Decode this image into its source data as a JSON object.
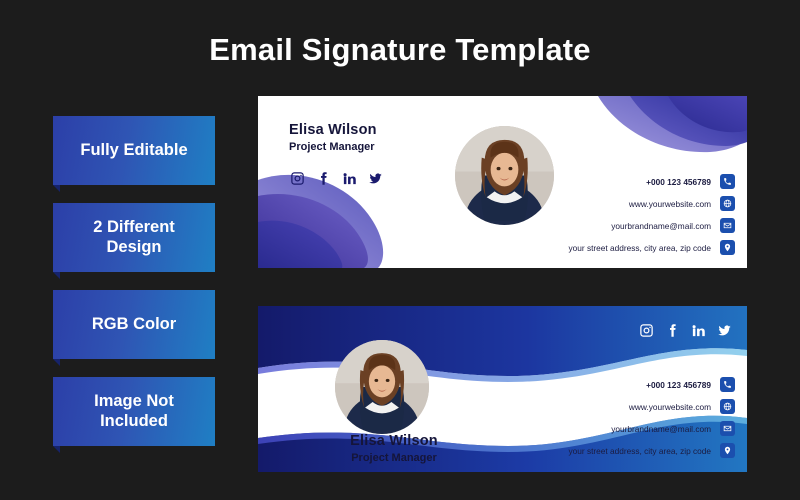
{
  "title": "Email Signature Template",
  "badges": [
    {
      "label": "Fully Editable"
    },
    {
      "label": "2 Different\nDesign"
    },
    {
      "label": "RGB Color"
    },
    {
      "label": "Image Not\nIncluded"
    }
  ],
  "signature": {
    "name": "Elisa Wilson",
    "role": "Project Manager",
    "socials": [
      {
        "icon": "instagram-icon",
        "name": "instagram"
      },
      {
        "icon": "facebook-icon",
        "name": "facebook"
      },
      {
        "icon": "linkedin-icon",
        "name": "linkedin"
      },
      {
        "icon": "twitter-icon",
        "name": "twitter"
      }
    ],
    "contacts": [
      {
        "icon": "phone-icon",
        "text": "+000 123 456789",
        "bold": true
      },
      {
        "icon": "globe-icon",
        "text": "www.yourwebsite.com",
        "bold": false
      },
      {
        "icon": "mail-icon",
        "text": "yourbrandname@mail.com",
        "bold": false
      },
      {
        "icon": "location-icon",
        "text": "your street address, city area, zip code",
        "bold": false
      }
    ]
  },
  "colors": {
    "background": "#1c1c1c",
    "card": "#ffffff",
    "accent_blue": "#1b4fae",
    "accent_deep": "#16236b",
    "accent_light": "#2f7fc6",
    "text_dark": "#15153a"
  }
}
